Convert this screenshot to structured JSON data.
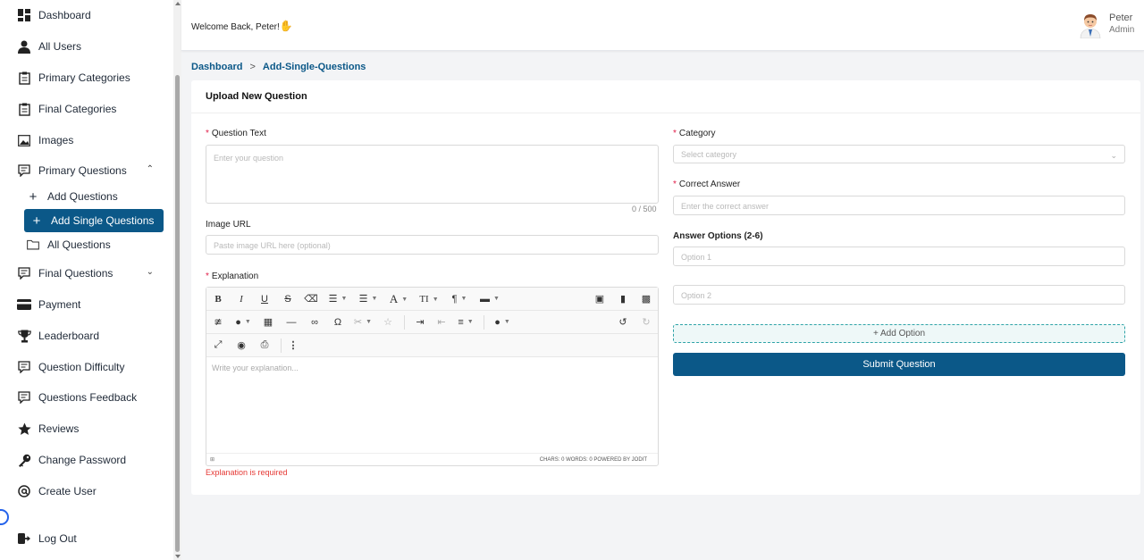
{
  "sidebar": {
    "items": [
      {
        "label": "Dashboard",
        "icon": "dashboard-icon"
      },
      {
        "label": "All Users",
        "icon": "user-icon"
      },
      {
        "label": "Primary Categories",
        "icon": "clipboard-icon"
      },
      {
        "label": "Final Categories",
        "icon": "clipboard-icon"
      },
      {
        "label": "Images",
        "icon": "image-icon"
      },
      {
        "label": "Primary Questions",
        "icon": "question-icon"
      },
      {
        "label": "Final Questions",
        "icon": "question-icon"
      },
      {
        "label": "Payment",
        "icon": "card-icon"
      },
      {
        "label": "Leaderboard",
        "icon": "trophy-icon"
      },
      {
        "label": "Question Difficulty",
        "icon": "question-icon"
      },
      {
        "label": "Questions Feedback",
        "icon": "question-icon"
      },
      {
        "label": "Reviews",
        "icon": "star-icon"
      },
      {
        "label": "Change Password",
        "icon": "key-icon"
      },
      {
        "label": "Create User",
        "icon": "at-icon"
      },
      {
        "label": "Log Out",
        "icon": "logout-icon"
      }
    ],
    "sub_items": [
      {
        "label": "Add Questions",
        "icon": "plus-icon"
      },
      {
        "label": "Add Single Questions",
        "icon": "plus-icon",
        "active": true
      },
      {
        "label": "All Questions",
        "icon": "folder-icon"
      }
    ]
  },
  "header": {
    "welcome": "Welcome Back, Peter!",
    "wave_icon": "waving-hand-icon",
    "user_name": "Peter",
    "user_role": "Admin"
  },
  "breadcrumb": {
    "home": "Dashboard",
    "separator": ">",
    "current": "Add-Single-Questions"
  },
  "form": {
    "title": "Upload New Question",
    "question_label": "Question Text",
    "question_placeholder": "Enter your question",
    "question_count": "0 / 500",
    "image_label": "Image URL",
    "image_placeholder": "Paste image URL here (optional)",
    "explanation_label": "Explanation",
    "explanation_placeholder": "Write your explanation...",
    "explanation_error": "Explanation is required",
    "editor_footer": "CHARS: 0   WORDS: 0   POWERED BY JODIT",
    "category_label": "Category",
    "category_placeholder": "Select category",
    "answer_label": "Correct Answer",
    "answer_placeholder": "Enter the correct answer",
    "options_label": "Answer Options (2-6)",
    "option1_placeholder": "Option 1",
    "option2_placeholder": "Option 2",
    "add_option": "+ Add Option",
    "submit": "Submit Question",
    "required_mark": "*"
  },
  "colors": {
    "primary": "#0b5888",
    "error": "#e53935",
    "required": "#e11d48",
    "dashed_accent": "#2ea3a7"
  }
}
